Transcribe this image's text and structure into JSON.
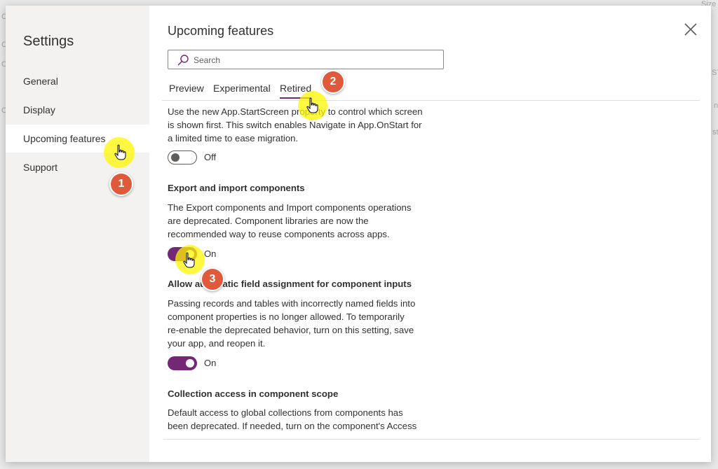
{
  "sidebar": {
    "title": "Settings",
    "items": [
      {
        "label": "General"
      },
      {
        "label": "Display"
      },
      {
        "label": "Upcoming features"
      },
      {
        "label": "Support"
      }
    ]
  },
  "main": {
    "title": "Upcoming features",
    "search_placeholder": "Search",
    "search_value": "",
    "tabs": [
      {
        "label": "Preview"
      },
      {
        "label": "Experimental"
      },
      {
        "label": "Retired",
        "active": true
      }
    ]
  },
  "features": [
    {
      "description_lines": [
        "Use the new App.StartScreen property to control which screen",
        "is shown first. This switch enables Navigate in App.OnStart for",
        "a limited time to ease migration."
      ],
      "toggle_state": "Off"
    },
    {
      "title": "Export and import components",
      "description_lines": [
        "The Export components and Import components operations",
        "are deprecated. Component libraries are now the",
        "recommended way to reuse components across apps."
      ],
      "toggle_state": "On"
    },
    {
      "title": "Allow automatic field assignment for component inputs",
      "description_lines": [
        "Passing records and tables with incorrectly named fields into",
        "component properties is no longer allowed. To temporarily",
        "re-enable the deprecated behavior, turn on this setting, save",
        "your app, and reopen it."
      ],
      "toggle_state": "On"
    },
    {
      "title": "Collection access in component scope",
      "description_lines": [
        "Default access to global collections from components has",
        "been deprecated. If needed, turn on the component's Access"
      ]
    }
  ],
  "annotations": {
    "step1": "1",
    "step2": "2",
    "step3": "3"
  },
  "background": {
    "fragments": [
      "Size",
      "C",
      "C",
      "C",
      "C",
      "ST",
      "n",
      "st"
    ]
  },
  "icons": {
    "close": "close-icon",
    "search": "search-icon",
    "cursor": "hand-pointer-icon"
  },
  "colors": {
    "accent": "#742774",
    "badge": "#df5a3a",
    "highlight": "#fff500",
    "sidebar_bg": "#f3f2f1"
  }
}
